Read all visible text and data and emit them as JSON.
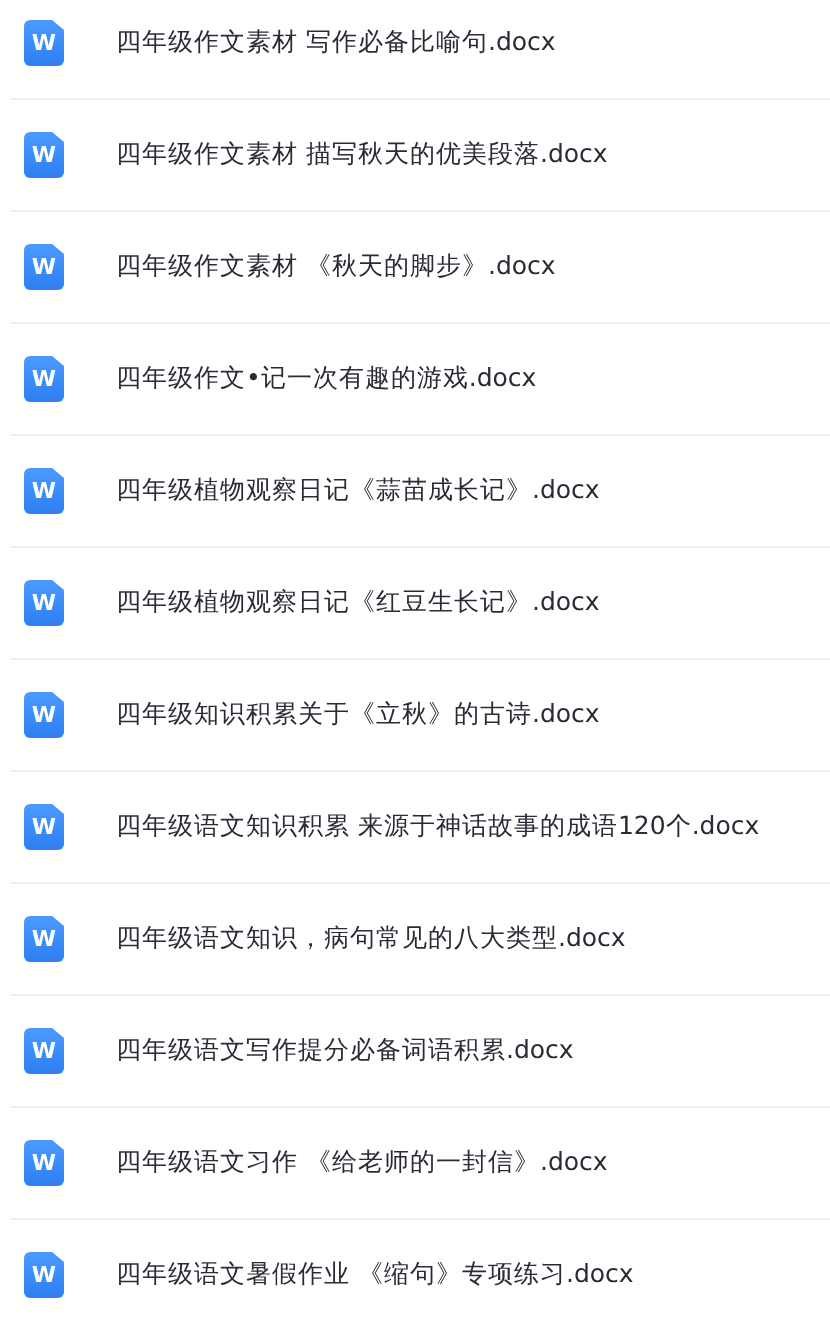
{
  "files": [
    {
      "icon_label": "W",
      "name": "四年级作文素材 写作必备比喻句.docx"
    },
    {
      "icon_label": "W",
      "name": "四年级作文素材 描写秋天的优美段落.docx"
    },
    {
      "icon_label": "W",
      "name": "四年级作文素材 《秋天的脚步》.docx"
    },
    {
      "icon_label": "W",
      "name": "四年级作文•记一次有趣的游戏.docx"
    },
    {
      "icon_label": "W",
      "name": "四年级植物观察日记《蒜苗成长记》.docx"
    },
    {
      "icon_label": "W",
      "name": "四年级植物观察日记《红豆生长记》.docx"
    },
    {
      "icon_label": "W",
      "name": "四年级知识积累关于《立秋》的古诗.docx"
    },
    {
      "icon_label": "W",
      "name": "四年级语文知识积累 来源于神话故事的成语120个.docx"
    },
    {
      "icon_label": "W",
      "name": "四年级语文知识，病句常见的八大类型.docx"
    },
    {
      "icon_label": "W",
      "name": "四年级语文写作提分必备词语积累.docx"
    },
    {
      "icon_label": "W",
      "name": "四年级语文习作 《给老师的一封信》.docx"
    },
    {
      "icon_label": "W",
      "name": "四年级语文暑假作业 《缩句》专项练习.docx"
    }
  ]
}
